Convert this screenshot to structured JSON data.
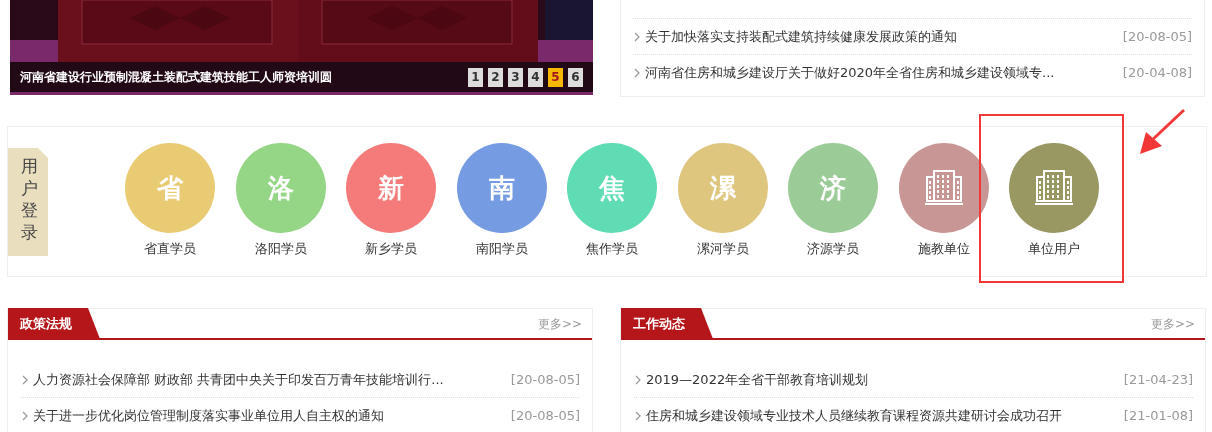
{
  "slideshow": {
    "caption": "河南省建设行业预制混凝土装配式建筑技能工人师资培训圆",
    "pages": [
      {
        "label": "1",
        "selected": false
      },
      {
        "label": "2",
        "selected": false
      },
      {
        "label": "3",
        "selected": false
      },
      {
        "label": "4",
        "selected": false
      },
      {
        "label": "5",
        "selected": true
      },
      {
        "label": "6",
        "selected": false
      }
    ]
  },
  "top_news": [
    {
      "title": "关于加快落实支持装配式建筑持续健康发展政策的通知",
      "date": "[20-08-05]"
    },
    {
      "title": "河南省住房和城乡建设厅关于做好2020年全省住房和城乡建设领域专...",
      "date": "[20-04-08]"
    }
  ],
  "login": {
    "label": "用户登录",
    "items": [
      {
        "kind": "text",
        "glyph": "省",
        "name": "省直学员",
        "color": "#e9cb73",
        "highlighted": false
      },
      {
        "kind": "text",
        "glyph": "洛",
        "name": "洛阳学员",
        "color": "#94d685",
        "highlighted": false
      },
      {
        "kind": "text",
        "glyph": "新",
        "name": "新乡学员",
        "color": "#f47b7a",
        "highlighted": false
      },
      {
        "kind": "text",
        "glyph": "南",
        "name": "南阳学员",
        "color": "#759be2",
        "highlighted": false
      },
      {
        "kind": "text",
        "glyph": "焦",
        "name": "焦作学员",
        "color": "#5fdcb3",
        "highlighted": false
      },
      {
        "kind": "text",
        "glyph": "漯",
        "name": "漯河学员",
        "color": "#dec67f",
        "highlighted": false
      },
      {
        "kind": "text",
        "glyph": "济",
        "name": "济源学员",
        "color": "#9bcc98",
        "highlighted": false
      },
      {
        "kind": "building",
        "name": "施教单位",
        "color": "#c89795",
        "highlighted": false
      },
      {
        "kind": "building",
        "name": "单位用户",
        "color": "#999862",
        "highlighted": true
      }
    ]
  },
  "panels": [
    {
      "title": "政策法规",
      "more": "更多>>",
      "items": [
        {
          "title": "人力资源社会保障部 财政部 共青团中央关于印发百万青年技能培训行...",
          "date": "[20-08-05]"
        },
        {
          "title": "关于进一步优化岗位管理制度落实事业单位用人自主权的通知",
          "date": "[20-08-05]"
        }
      ]
    },
    {
      "title": "工作动态",
      "more": "更多>>",
      "items": [
        {
          "title": "2019—2022年全省干部教育培训规划",
          "date": "[21-04-23]"
        },
        {
          "title": "住房和城乡建设领域专业技术人员继续教育课程资源共建研讨会成功召开",
          "date": "[21-01-08]"
        }
      ]
    }
  ]
}
